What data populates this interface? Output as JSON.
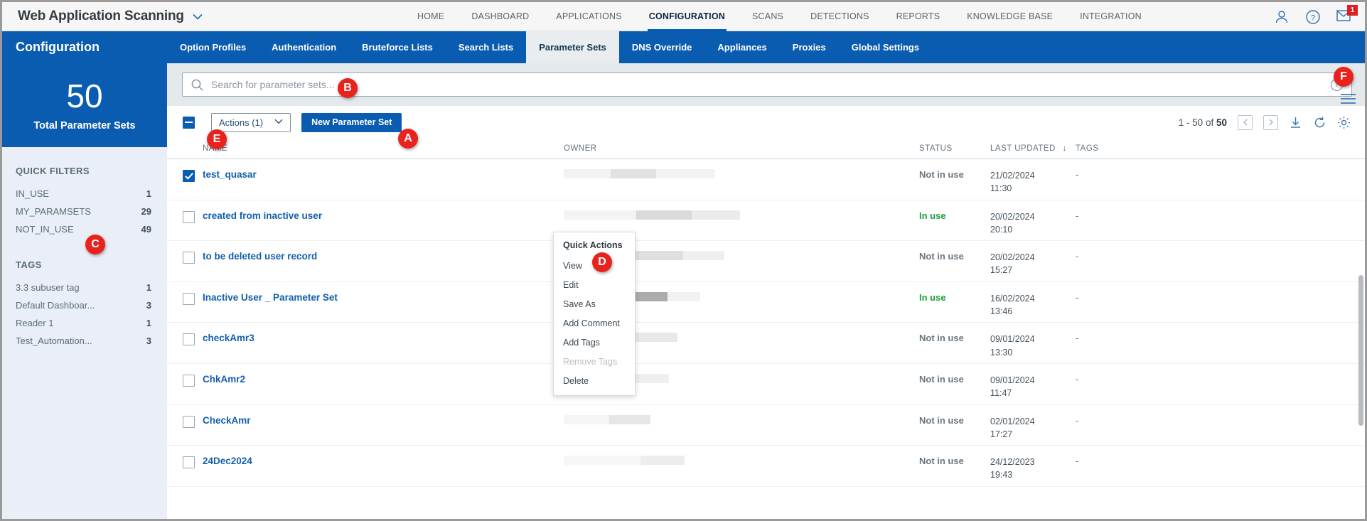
{
  "topbar": {
    "app_title": "Web Application Scanning",
    "caret_icon": "chevron-down-icon",
    "nav": [
      {
        "label": "HOME",
        "active": false
      },
      {
        "label": "DASHBOARD",
        "active": false
      },
      {
        "label": "APPLICATIONS",
        "active": false
      },
      {
        "label": "CONFIGURATION",
        "active": true
      },
      {
        "label": "SCANS",
        "active": false
      },
      {
        "label": "DETECTIONS",
        "active": false
      },
      {
        "label": "REPORTS",
        "active": false
      },
      {
        "label": "KNOWLEDGE BASE",
        "active": false
      },
      {
        "label": "INTEGRATION",
        "active": false
      }
    ],
    "icons": [
      {
        "name": "user-icon"
      },
      {
        "name": "help-icon"
      },
      {
        "name": "mail-icon",
        "badge": "1"
      }
    ]
  },
  "subheader": {
    "title": "Configuration",
    "tabs": [
      {
        "label": "Option Profiles",
        "active": false
      },
      {
        "label": "Authentication",
        "active": false
      },
      {
        "label": "Bruteforce Lists",
        "active": false
      },
      {
        "label": "Search Lists",
        "active": false
      },
      {
        "label": "Parameter Sets",
        "active": true
      },
      {
        "label": "DNS Override",
        "active": false
      },
      {
        "label": "Appliances",
        "active": false
      },
      {
        "label": "Proxies",
        "active": false
      },
      {
        "label": "Global Settings",
        "active": false
      }
    ]
  },
  "sidebar": {
    "kpi_value": "50",
    "kpi_label": "Total Parameter Sets",
    "quick_filters_title": "QUICK FILTERS",
    "quick_filters": [
      {
        "label": "IN_USE",
        "count": "1"
      },
      {
        "label": "MY_PARAMSETS",
        "count": "29"
      },
      {
        "label": "NOT_IN_USE",
        "count": "49"
      }
    ],
    "tags_title": "TAGS",
    "tags": [
      {
        "label": "3.3 subuser tag",
        "count": "1"
      },
      {
        "label": "Default Dashboar...",
        "count": "3"
      },
      {
        "label": "Reader 1",
        "count": "1"
      },
      {
        "label": "Test_Automation...",
        "count": "3"
      }
    ]
  },
  "search": {
    "placeholder": "Search for parameter sets...",
    "value": "",
    "search_icon": "search-icon",
    "help_icon": "question-mark-icon"
  },
  "toolbar": {
    "select_all_state": "indeterminate",
    "actions_label": "Actions (1)",
    "actions_caret": "chevron-down-icon",
    "new_button_label": "New Parameter Set",
    "pager_prefix": "1 - 50 of ",
    "pager_total": "50",
    "prev_icon": "chevron-left-icon",
    "next_icon": "chevron-right-icon",
    "download_icon": "download-icon",
    "refresh_icon": "refresh-icon",
    "settings_icon": "gear-icon",
    "hamburger_icon": "hamburger-menu-icon"
  },
  "table": {
    "columns": [
      "NAME",
      "OWNER",
      "STATUS",
      "LAST UPDATED",
      "TAGS"
    ],
    "sort_column": "LAST UPDATED",
    "sort_icon": "arrow-down-icon",
    "rows": [
      {
        "selected": true,
        "name": "test_quasar",
        "owner": "",
        "status": "Not in use",
        "in_use": false,
        "date": "21/02/2024",
        "time": "11:30",
        "tags": "-"
      },
      {
        "selected": false,
        "name": "created from inactive user",
        "owner": "",
        "status": "In use",
        "in_use": true,
        "date": "20/02/2024",
        "time": "20:10",
        "tags": "-"
      },
      {
        "selected": false,
        "name": "to be deleted user record",
        "owner": "",
        "status": "Not in use",
        "in_use": false,
        "date": "20/02/2024",
        "time": "15:27",
        "tags": "-"
      },
      {
        "selected": false,
        "name": "Inactive User _ Parameter Set",
        "owner": "",
        "status": "In use",
        "in_use": true,
        "date": "16/02/2024",
        "time": "13:46",
        "tags": "-"
      },
      {
        "selected": false,
        "name": "checkAmr3",
        "owner": "",
        "status": "Not in use",
        "in_use": false,
        "date": "09/01/2024",
        "time": "13:30",
        "tags": "-"
      },
      {
        "selected": false,
        "name": "ChkAmr2",
        "owner": "",
        "status": "Not in use",
        "in_use": false,
        "date": "09/01/2024",
        "time": "11:47",
        "tags": "-"
      },
      {
        "selected": false,
        "name": "CheckAmr",
        "owner": "",
        "status": "Not in use",
        "in_use": false,
        "date": "02/01/2024",
        "time": "17:27",
        "tags": "-"
      },
      {
        "selected": false,
        "name": "24Dec2024",
        "owner": "",
        "status": "Not in use",
        "in_use": false,
        "date": "24/12/2023",
        "time": "19:43",
        "tags": "-"
      }
    ]
  },
  "quick_actions_menu": {
    "title": "Quick Actions",
    "items": [
      {
        "label": "View",
        "disabled": false
      },
      {
        "label": "Edit",
        "disabled": false
      },
      {
        "label": "Save As",
        "disabled": false
      },
      {
        "label": "Add Comment",
        "disabled": false
      },
      {
        "label": "Add Tags",
        "disabled": false
      },
      {
        "label": "Remove Tags",
        "disabled": true
      },
      {
        "label": "Delete",
        "disabled": false
      }
    ]
  },
  "markers": [
    {
      "id": "A",
      "label": "A"
    },
    {
      "id": "B",
      "label": "B"
    },
    {
      "id": "C",
      "label": "C"
    },
    {
      "id": "D",
      "label": "D"
    },
    {
      "id": "E",
      "label": "E"
    },
    {
      "id": "F",
      "label": "F"
    }
  ],
  "colors": {
    "brand_blue": "#0a5cb0",
    "marker_red": "#e8231e",
    "in_use_green": "#18a03a",
    "link_blue": "#125fad",
    "sidebar_bg": "#e9eef7"
  }
}
